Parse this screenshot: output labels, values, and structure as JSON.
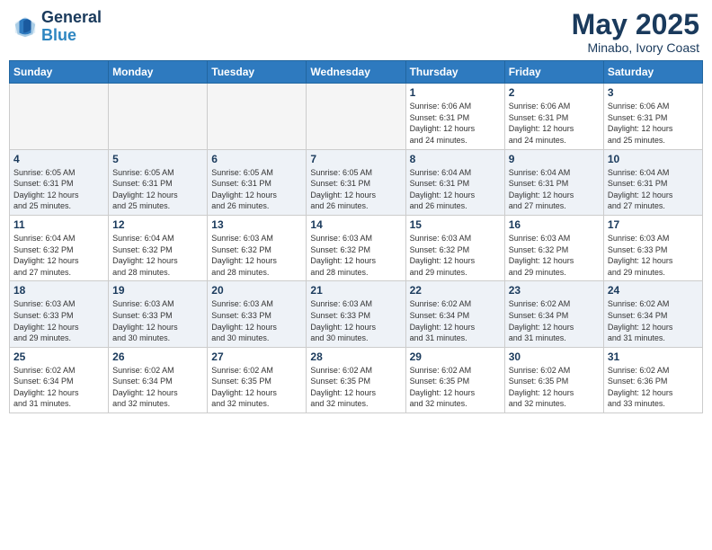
{
  "header": {
    "logo_line1": "General",
    "logo_line2": "Blue",
    "month": "May 2025",
    "location": "Minabo, Ivory Coast"
  },
  "weekdays": [
    "Sunday",
    "Monday",
    "Tuesday",
    "Wednesday",
    "Thursday",
    "Friday",
    "Saturday"
  ],
  "weeks": [
    [
      {
        "day": "",
        "info": ""
      },
      {
        "day": "",
        "info": ""
      },
      {
        "day": "",
        "info": ""
      },
      {
        "day": "",
        "info": ""
      },
      {
        "day": "1",
        "info": "Sunrise: 6:06 AM\nSunset: 6:31 PM\nDaylight: 12 hours\nand 24 minutes."
      },
      {
        "day": "2",
        "info": "Sunrise: 6:06 AM\nSunset: 6:31 PM\nDaylight: 12 hours\nand 24 minutes."
      },
      {
        "day": "3",
        "info": "Sunrise: 6:06 AM\nSunset: 6:31 PM\nDaylight: 12 hours\nand 25 minutes."
      }
    ],
    [
      {
        "day": "4",
        "info": "Sunrise: 6:05 AM\nSunset: 6:31 PM\nDaylight: 12 hours\nand 25 minutes."
      },
      {
        "day": "5",
        "info": "Sunrise: 6:05 AM\nSunset: 6:31 PM\nDaylight: 12 hours\nand 25 minutes."
      },
      {
        "day": "6",
        "info": "Sunrise: 6:05 AM\nSunset: 6:31 PM\nDaylight: 12 hours\nand 26 minutes."
      },
      {
        "day": "7",
        "info": "Sunrise: 6:05 AM\nSunset: 6:31 PM\nDaylight: 12 hours\nand 26 minutes."
      },
      {
        "day": "8",
        "info": "Sunrise: 6:04 AM\nSunset: 6:31 PM\nDaylight: 12 hours\nand 26 minutes."
      },
      {
        "day": "9",
        "info": "Sunrise: 6:04 AM\nSunset: 6:31 PM\nDaylight: 12 hours\nand 27 minutes."
      },
      {
        "day": "10",
        "info": "Sunrise: 6:04 AM\nSunset: 6:31 PM\nDaylight: 12 hours\nand 27 minutes."
      }
    ],
    [
      {
        "day": "11",
        "info": "Sunrise: 6:04 AM\nSunset: 6:32 PM\nDaylight: 12 hours\nand 27 minutes."
      },
      {
        "day": "12",
        "info": "Sunrise: 6:04 AM\nSunset: 6:32 PM\nDaylight: 12 hours\nand 28 minutes."
      },
      {
        "day": "13",
        "info": "Sunrise: 6:03 AM\nSunset: 6:32 PM\nDaylight: 12 hours\nand 28 minutes."
      },
      {
        "day": "14",
        "info": "Sunrise: 6:03 AM\nSunset: 6:32 PM\nDaylight: 12 hours\nand 28 minutes."
      },
      {
        "day": "15",
        "info": "Sunrise: 6:03 AM\nSunset: 6:32 PM\nDaylight: 12 hours\nand 29 minutes."
      },
      {
        "day": "16",
        "info": "Sunrise: 6:03 AM\nSunset: 6:32 PM\nDaylight: 12 hours\nand 29 minutes."
      },
      {
        "day": "17",
        "info": "Sunrise: 6:03 AM\nSunset: 6:33 PM\nDaylight: 12 hours\nand 29 minutes."
      }
    ],
    [
      {
        "day": "18",
        "info": "Sunrise: 6:03 AM\nSunset: 6:33 PM\nDaylight: 12 hours\nand 29 minutes."
      },
      {
        "day": "19",
        "info": "Sunrise: 6:03 AM\nSunset: 6:33 PM\nDaylight: 12 hours\nand 30 minutes."
      },
      {
        "day": "20",
        "info": "Sunrise: 6:03 AM\nSunset: 6:33 PM\nDaylight: 12 hours\nand 30 minutes."
      },
      {
        "day": "21",
        "info": "Sunrise: 6:03 AM\nSunset: 6:33 PM\nDaylight: 12 hours\nand 30 minutes."
      },
      {
        "day": "22",
        "info": "Sunrise: 6:02 AM\nSunset: 6:34 PM\nDaylight: 12 hours\nand 31 minutes."
      },
      {
        "day": "23",
        "info": "Sunrise: 6:02 AM\nSunset: 6:34 PM\nDaylight: 12 hours\nand 31 minutes."
      },
      {
        "day": "24",
        "info": "Sunrise: 6:02 AM\nSunset: 6:34 PM\nDaylight: 12 hours\nand 31 minutes."
      }
    ],
    [
      {
        "day": "25",
        "info": "Sunrise: 6:02 AM\nSunset: 6:34 PM\nDaylight: 12 hours\nand 31 minutes."
      },
      {
        "day": "26",
        "info": "Sunrise: 6:02 AM\nSunset: 6:34 PM\nDaylight: 12 hours\nand 32 minutes."
      },
      {
        "day": "27",
        "info": "Sunrise: 6:02 AM\nSunset: 6:35 PM\nDaylight: 12 hours\nand 32 minutes."
      },
      {
        "day": "28",
        "info": "Sunrise: 6:02 AM\nSunset: 6:35 PM\nDaylight: 12 hours\nand 32 minutes."
      },
      {
        "day": "29",
        "info": "Sunrise: 6:02 AM\nSunset: 6:35 PM\nDaylight: 12 hours\nand 32 minutes."
      },
      {
        "day": "30",
        "info": "Sunrise: 6:02 AM\nSunset: 6:35 PM\nDaylight: 12 hours\nand 32 minutes."
      },
      {
        "day": "31",
        "info": "Sunrise: 6:02 AM\nSunset: 6:36 PM\nDaylight: 12 hours\nand 33 minutes."
      }
    ]
  ]
}
